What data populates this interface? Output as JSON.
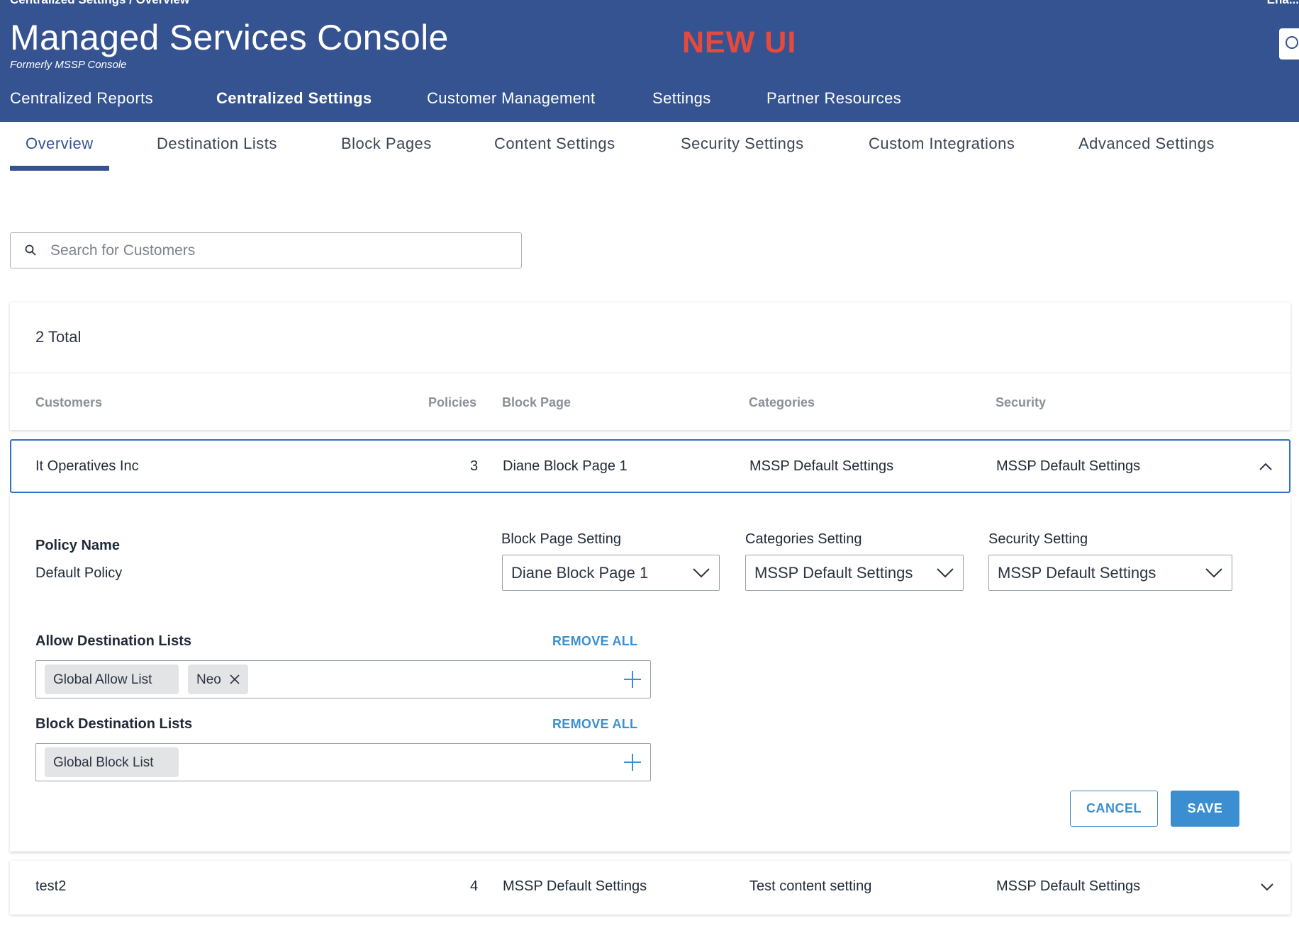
{
  "header": {
    "breadcrumb": "Centralized Settings / Overview",
    "user": "Ena...",
    "title": "Managed Services Console",
    "subtitle": "Formerly MSSP Console",
    "banner": "NEW UI",
    "nav": [
      "Centralized Reports",
      "Centralized Settings",
      "Customer Management",
      "Settings",
      "Partner Resources"
    ],
    "active_nav": "Centralized Settings"
  },
  "sub_nav": {
    "tabs": [
      "Overview",
      "Destination Lists",
      "Block Pages",
      "Content Settings",
      "Security Settings",
      "Custom Integrations",
      "Advanced Settings"
    ],
    "active_tab": "Overview"
  },
  "search": {
    "placeholder": "Search for Customers",
    "value": ""
  },
  "table": {
    "total_label": "2 Total",
    "columns": [
      "Customers",
      "Policies",
      "Block Page",
      "Categories",
      "Security"
    ],
    "rows": [
      {
        "customer": "It Operatives Inc",
        "policies": "3",
        "block_page": "Diane Block Page 1",
        "categories": "MSSP Default Settings",
        "security": "MSSP Default Settings",
        "expanded": true
      },
      {
        "customer": "test2",
        "policies": "4",
        "block_page": "MSSP Default Settings",
        "categories": "Test content setting",
        "security": "MSSP Default Settings",
        "expanded": false
      }
    ]
  },
  "detail": {
    "policy_name_label": "Policy Name",
    "policy_name_value": "Default Policy",
    "block_page_setting_label": "Block Page Setting",
    "block_page_setting_value": "Diane Block Page 1",
    "categories_setting_label": "Categories Setting",
    "categories_setting_value": "MSSP Default Settings",
    "security_setting_label": "Security Setting",
    "security_setting_value": "MSSP Default Settings",
    "allow_lists_label": "Allow Destination Lists",
    "allow_lists_chips": [
      "Global Allow List",
      "Neo"
    ],
    "block_lists_label": "Block Destination Lists",
    "block_lists_chips": [
      "Global Block List"
    ],
    "remove_all_label": "REMOVE ALL",
    "cancel_label": "CANCEL",
    "save_label": "SAVE"
  },
  "colors": {
    "header_bg": "#355390",
    "banner": "#e8493d",
    "accent": "#3b8fd0",
    "selected_border": "#2f6fc6"
  }
}
